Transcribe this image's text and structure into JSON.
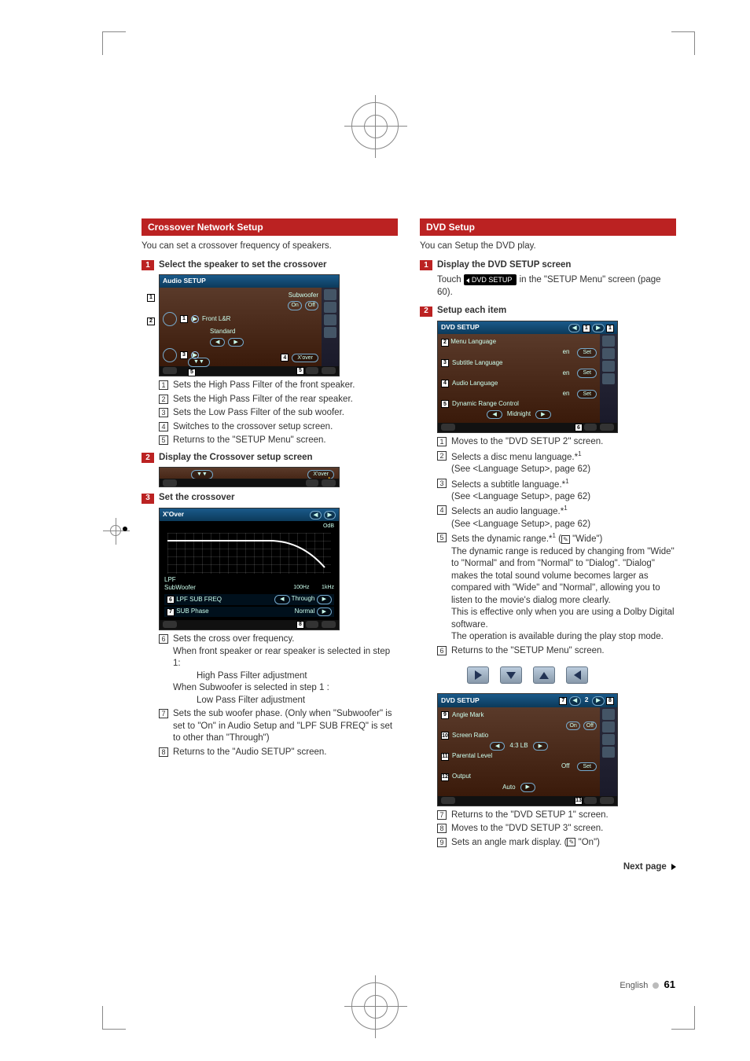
{
  "left": {
    "section_title": "Crossover Network Setup",
    "intro": "You can set a crossover frequency of speakers.",
    "step1": {
      "num": "1",
      "title": "Select the speaker to set the crossover"
    },
    "scr1": {
      "title": "Audio SETUP",
      "subwoofer_lbl": "Subwoofer",
      "on": "On",
      "off": "Off",
      "front_lbl": "Front L&R",
      "front_val": "Standard",
      "xover_btn": "X'over"
    },
    "items1": [
      {
        "n": "1",
        "t": "Sets the High Pass Filter of the front speaker."
      },
      {
        "n": "2",
        "t": "Sets the High Pass Filter of the rear speaker."
      },
      {
        "n": "3",
        "t": "Sets the Low Pass Filter of the sub woofer."
      },
      {
        "n": "4",
        "t": "Switches to the crossover setup screen."
      },
      {
        "n": "5",
        "t": "Returns to the \"SETUP Menu\" screen."
      }
    ],
    "step2": {
      "num": "2",
      "title": "Display the Crossover setup screen"
    },
    "mini": {
      "xover_btn": "X'over"
    },
    "step3": {
      "num": "3",
      "title": "Set the crossover"
    },
    "xover_scr": {
      "title": "X'Over",
      "odb": "OdB",
      "lpf_lbl": "LPF",
      "sw_lbl": "SubWoofer",
      "x100": "100Hz",
      "x1k": "1kHz",
      "row_freq_lbl": "LPF SUB FREQ",
      "row_freq_val": "Through",
      "row_phase_lbl": "SUB Phase",
      "row_phase_val": "Normal"
    },
    "items2": [
      {
        "n": "6",
        "t": "Sets the cross over frequency.",
        "sub": [
          "When front speaker or rear speaker is selected in step 1:",
          "High Pass Filter adjustment",
          "When Subwoofer is selected in step 1 :",
          "Low Pass Filter adjustment"
        ]
      },
      {
        "n": "7",
        "t": "Sets the sub woofer phase. (Only when \"Subwoofer\" is set to \"On\" in Audio Setup and \"LPF SUB FREQ\" is set to other than \"Through\")"
      },
      {
        "n": "8",
        "t": "Returns to the \"Audio SETUP\" screen."
      }
    ]
  },
  "right": {
    "section_title": "DVD Setup",
    "intro": "You can Setup the DVD play.",
    "step1": {
      "num": "1",
      "title": "Display the DVD SETUP screen"
    },
    "touch_pre": "Touch ",
    "touch_btn": "DVD SETUP",
    "touch_post": " in the \"SETUP Menu\" screen (page 60).",
    "step2": {
      "num": "2",
      "title": "Setup each item"
    },
    "scr1": {
      "title": "DVD SETUP",
      "rows": [
        {
          "lbl": "Menu Language",
          "val": "en",
          "btn": "Set"
        },
        {
          "lbl": "Subtitle Language",
          "val": "en",
          "btn": "Set"
        },
        {
          "lbl": "Audio Language",
          "val": "en",
          "btn": "Set"
        }
      ],
      "drc_lbl": "Dynamic Range Control",
      "drc_val": "Midnight"
    },
    "items1": [
      {
        "n": "1",
        "t": "Moves to the \"DVD SETUP 2\" screen."
      },
      {
        "n": "2",
        "t": "Selects a disc menu language.*",
        "s1": "1",
        "sub": "(See <Language Setup>, page 62)"
      },
      {
        "n": "3",
        "t": "Selects a subtitle language.*",
        "s1": "1",
        "sub": "(See <Language Setup>, page 62)"
      },
      {
        "n": "4",
        "t": "Selects an audio language.*",
        "s1": "1",
        "sub": "(See <Language Setup>, page 62)"
      },
      {
        "n": "5",
        "t": "Sets the dynamic range.*",
        "s1": "1",
        "pen": "✎",
        "extra": " \"Wide\")",
        "long": "The dynamic range is reduced by changing from \"Wide\" to \"Normal\" and from \"Normal\" to \"Dialog\". \"Dialog\" makes the total sound volume becomes larger as compared with \"Wide\" and \"Normal\", allowing you to listen to the movie's dialog more clearly.\nThis is effective only when you are using a Dolby Digital software.\nThe operation is available during the play stop mode."
      },
      {
        "n": "6",
        "t": "Returns to the \"SETUP Menu\" screen."
      }
    ],
    "scr2": {
      "title": "DVD SETUP",
      "angle_lbl": "Angle Mark",
      "on": "On",
      "off": "Off",
      "ratio_lbl": "Screen Ratio",
      "ratio_val": "4:3 LB",
      "parental_lbl": "Parental Level",
      "parental_val": "Off",
      "parental_btn": "Set",
      "output_lbl": "Output",
      "output_val": "Auto"
    },
    "items2": [
      {
        "n": "7",
        "t": "Returns to the \"DVD SETUP 1\" screen."
      },
      {
        "n": "8",
        "t": "Moves to the \"DVD SETUP 3\" screen."
      },
      {
        "n": "9",
        "t": "Sets an angle mark display. (",
        "pen": "✎",
        "extra": " \"On\")"
      }
    ],
    "nextpage": "Next page"
  },
  "footer": {
    "lang": "English",
    "page": "61"
  }
}
